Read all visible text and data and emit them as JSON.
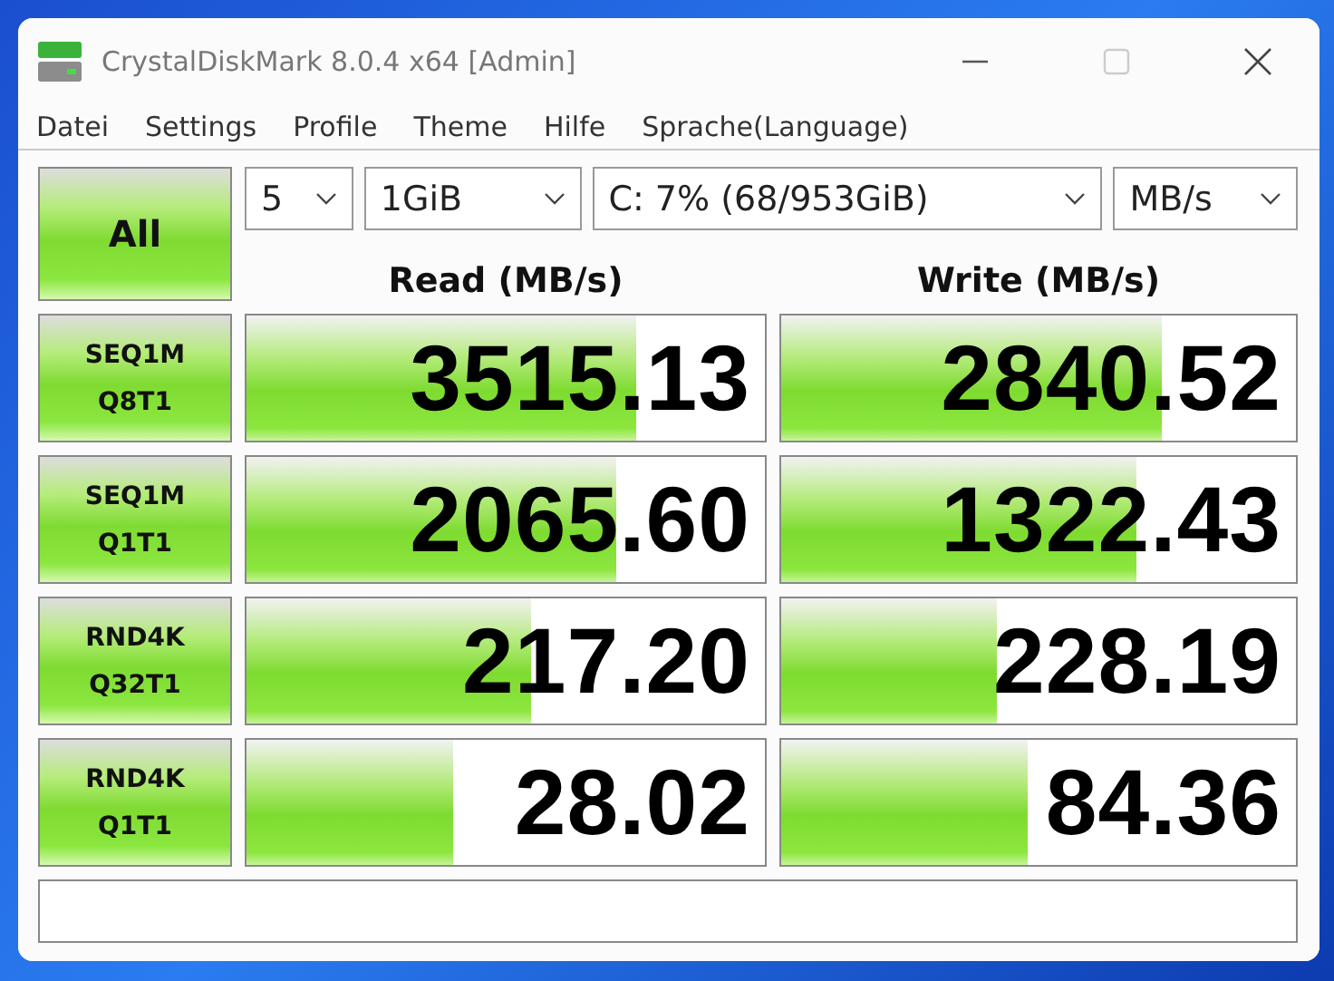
{
  "window": {
    "title": "CrystalDiskMark 8.0.4 x64 [Admin]"
  },
  "menu": [
    "Datei",
    "Settings",
    "Profile",
    "Theme",
    "Hilfe",
    "Sprache(Language)"
  ],
  "all_button": "All",
  "selectors": [
    {
      "value": "5"
    },
    {
      "value": "1GiB"
    },
    {
      "value": "C: 7% (68/953GiB)"
    },
    {
      "value": "MB/s"
    }
  ],
  "columns": [
    "Read (MB/s)",
    "Write (MB/s)"
  ],
  "rows": [
    {
      "test": [
        "SEQ1M",
        "Q8T1"
      ],
      "read": {
        "value": "3515.13",
        "level": 0.75
      },
      "write": {
        "value": "2840.52",
        "level": 0.74
      }
    },
    {
      "test": [
        "SEQ1M",
        "Q1T1"
      ],
      "read": {
        "value": "2065.60",
        "level": 0.715
      },
      "write": {
        "value": "1322.43",
        "level": 0.69
      }
    },
    {
      "test": [
        "RND4K",
        "Q32T1"
      ],
      "read": {
        "value": "217.20",
        "level": 0.55
      },
      "write": {
        "value": "228.19",
        "level": 0.42
      }
    },
    {
      "test": [
        "RND4K",
        "Q1T1"
      ],
      "read": {
        "value": "28.02",
        "level": 0.4
      },
      "write": {
        "value": "84.36",
        "level": 0.48
      }
    }
  ]
}
